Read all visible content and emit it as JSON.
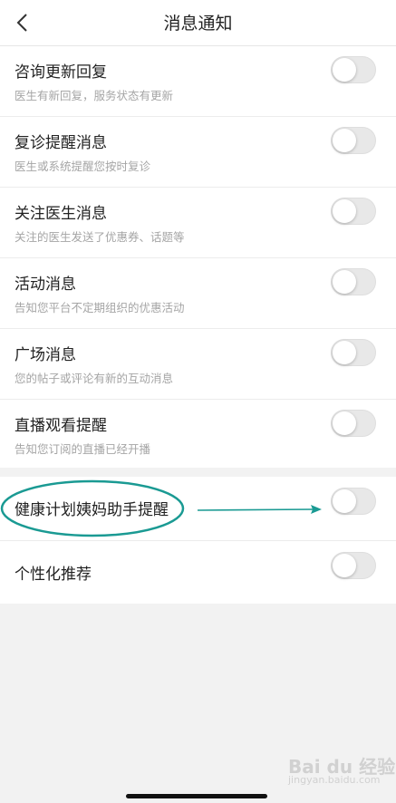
{
  "header": {
    "title": "消息通知"
  },
  "settings": [
    {
      "title": "咨询更新回复",
      "subtitle": "医生有新回复，服务状态有更新",
      "enabled": false
    },
    {
      "title": "复诊提醒消息",
      "subtitle": "医生或系统提醒您按时复诊",
      "enabled": false
    },
    {
      "title": "关注医生消息",
      "subtitle": "关注的医生发送了优惠券、话题等",
      "enabled": false
    },
    {
      "title": "活动消息",
      "subtitle": "告知您平台不定期组织的优惠活动",
      "enabled": false
    },
    {
      "title": "广场消息",
      "subtitle": "您的帖子或评论有新的互动消息",
      "enabled": false
    },
    {
      "title": "直播观看提醒",
      "subtitle": "告知您订阅的直播已经开播",
      "enabled": false
    }
  ],
  "settings2": [
    {
      "title": "健康计划姨妈助手提醒",
      "enabled": false
    },
    {
      "title": "个性化推荐",
      "enabled": false
    }
  ],
  "annotation_color": "#1a9a93",
  "watermark": {
    "main": "Bai du 经验",
    "sub": "jingyan.baidu.com"
  }
}
